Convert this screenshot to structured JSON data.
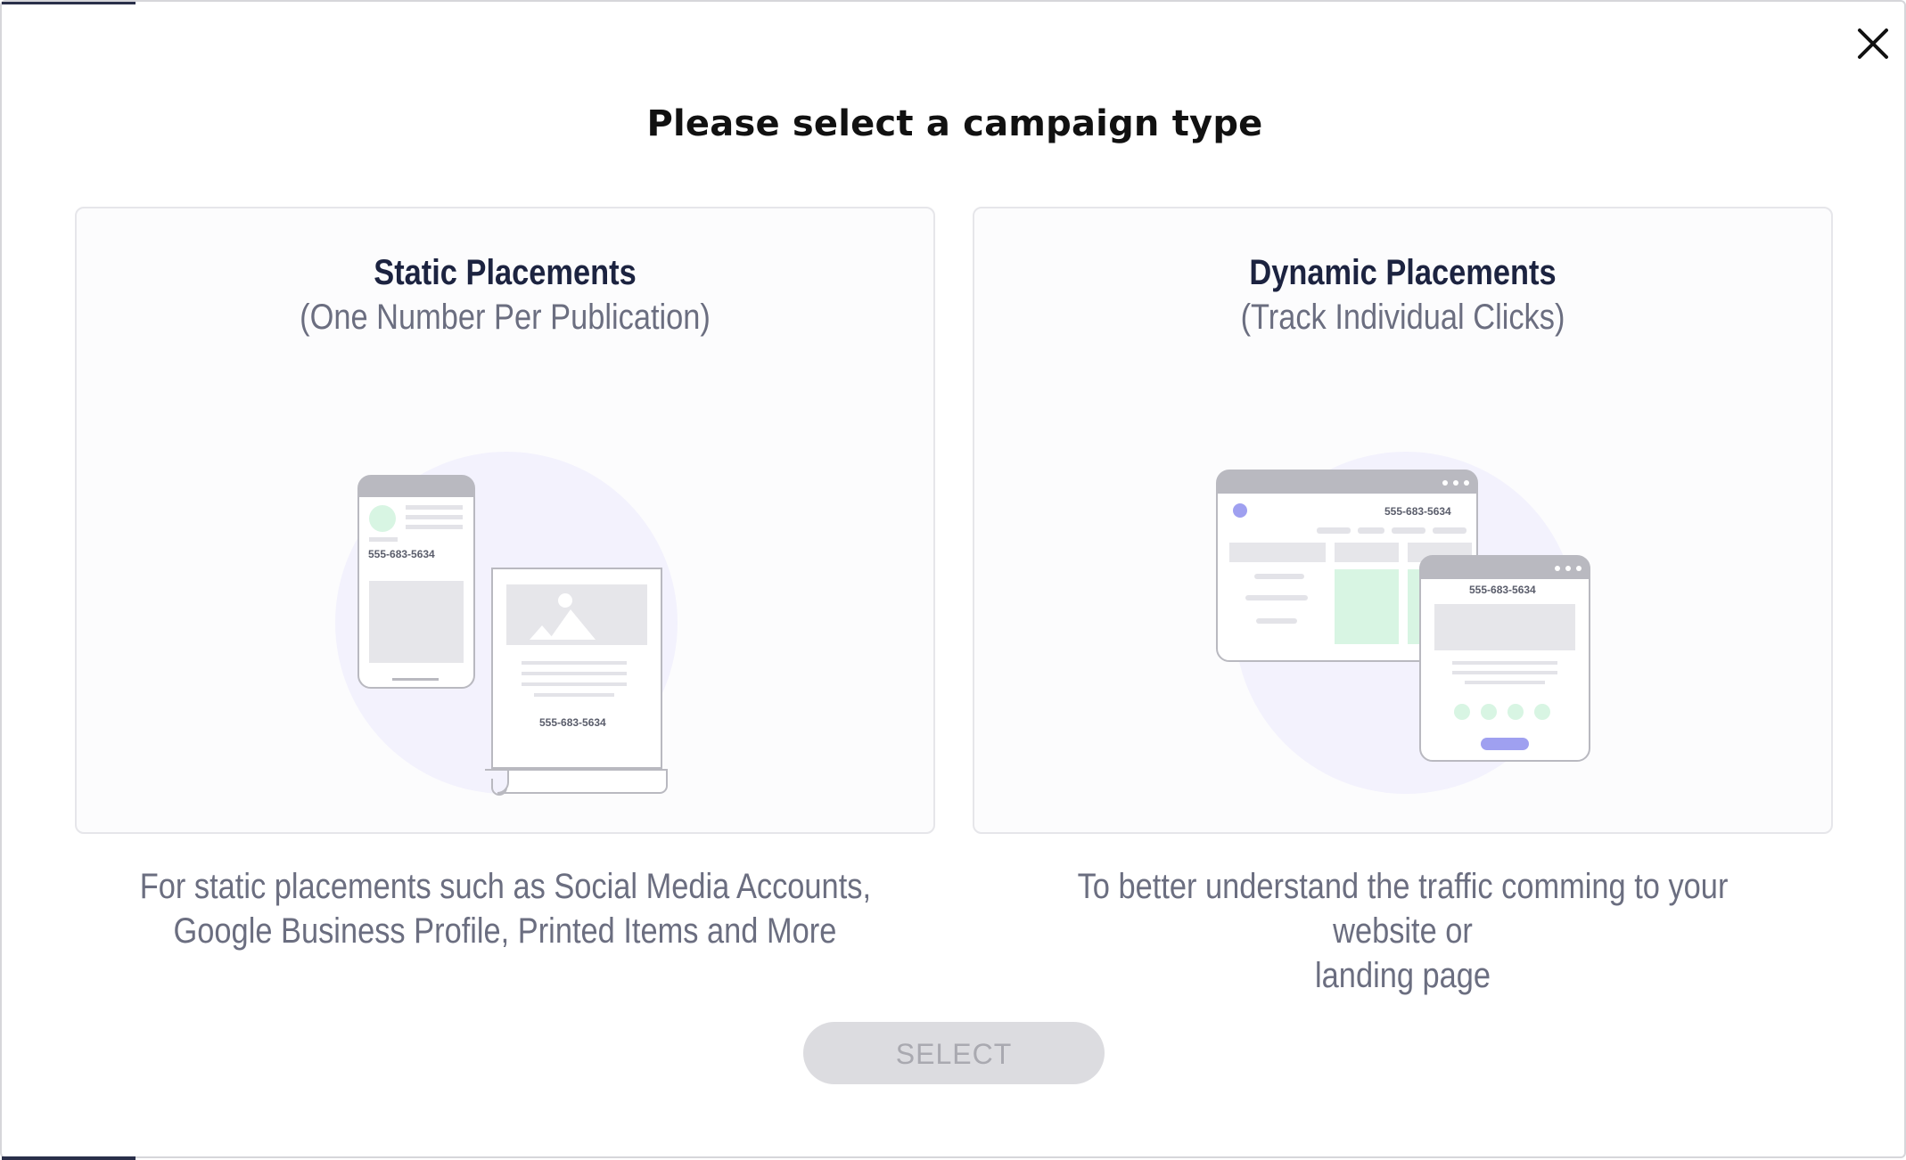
{
  "modal": {
    "title": "Please select a campaign type",
    "close_icon": "close-icon"
  },
  "options": [
    {
      "title": "Static Placements",
      "subtitle": "(One Number Per Publication)",
      "description_line1": "For static placements such as Social Media Accounts,",
      "description_line2": "Google Business Profile, Printed Items and More",
      "illustration": {
        "phone_number_1": "555-683-5634",
        "phone_number_2": "555-683-5634"
      }
    },
    {
      "title": "Dynamic Placements",
      "subtitle": "(Track Individual Clicks)",
      "description_line1": "To better understand the traffic comming to your website or",
      "description_line2": "landing page",
      "illustration": {
        "phone_number_1": "555-683-5634",
        "phone_number_2": "555-683-5634"
      }
    }
  ],
  "select_button": {
    "label": "SELECT",
    "state": "disabled"
  },
  "colors": {
    "accent_purple": "#9fa0f0",
    "accent_green": "#d8f5e3",
    "circle_bg": "#f3f2fd",
    "button_disabled_bg": "#dcdce0",
    "title_color": "#1c2340"
  }
}
